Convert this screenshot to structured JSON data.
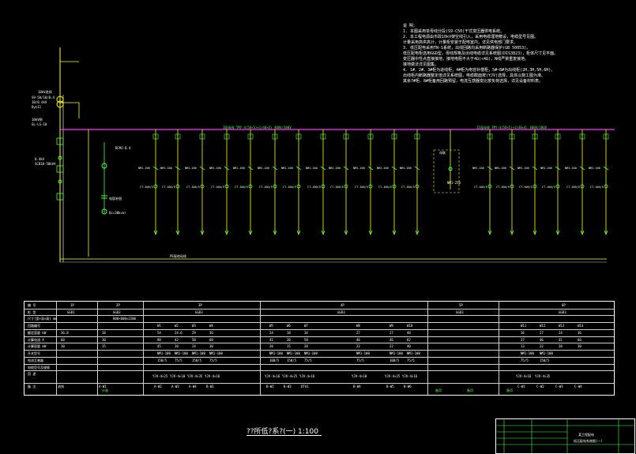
{
  "notes": {
    "heading": "说 明：",
    "lines": [
      "1. 本图采用单母线分段(S9-C50)干式变压器供电系统。",
      "2. 本工程电源由市政10kV架空线引入，采用电缆埋地敷设，电缆型号见图。",
      "   计量采用高供高计，计量柜安装于配电室内，详见供电部门要求。",
      "3. 低压配电采用TN-S系统，出线回路均采用断路器保护(GB 50053)。",
      "   低压配电柜选用GGD型，母线规格及出线电缆详见系统图(DIS3823)，柜体尺寸见平面。",
      "   变压器中性点直接接地，接地电阻不大于4Ω(<4Ω)，N线严禁重复接地。",
      "   接地做法详见图集。",
      "4. 1#、2#、3#柜为进线柜，4#柜为电容补偿柜，5#~8#为出线柜(2H,3H,5H,6H)。",
      "   出线柜内断路器整定值详见系统图，电缆截面按(YJV)选择，具体以施工图为准。",
      "   其余7#柜、8#柜备用回路预留，电流互感器变比按负荷选择，详见设备材料表。"
    ]
  },
  "diagram": {
    "left_labels": [
      "10kV进线",
      "S9-50/10/0.4",
      "10/0.4kV",
      "Dyn11",
      "10kV侧",
      "GL-LS-10",
      "0.4kV",
      "SCB10-50kVA"
    ],
    "bus1_label": "I段母线 TMY-4(50×5)+1(40×4) 400V/380V",
    "bus2_label": "II段母线 TMY-4(50×5)+1(40×4) 400V/380V",
    "ground_bus_label": "PE接地母线",
    "capacitor_labels": [
      "BCMJ-0.4",
      "电容补偿",
      "Qc=30kvar"
    ],
    "feeder_badge": "1",
    "breaker_label": "NM1-100",
    "ct_label": "CT-100/5",
    "tie_label": "母联",
    "tie_switch": "NM1-250"
  },
  "table": {
    "row_labels": [
      "编 号",
      "柜 型",
      "尺寸(宽×深×高) mm",
      "回路编号",
      "额定容量 kW",
      "计算电流 A",
      "计算容量 kW",
      "开关型号",
      "电流互感器",
      "电缆型号及规格",
      "用 途",
      "备 注"
    ],
    "col_headers": [
      "1P",
      "2P",
      "3P",
      "4P",
      "5P",
      "6P"
    ],
    "cabinet_types": [
      "GGD1",
      "GGD2",
      "GGD3",
      "GGD3",
      "GGD3",
      "GGD3"
    ],
    "circuit_ids": [
      "W1",
      "W2",
      "W3",
      "W4",
      "W5",
      "W6",
      "W7",
      "W8",
      "W9",
      "W10",
      "W11",
      "W12",
      "W13",
      "W14"
    ],
    "capacity": [
      "36.8",
      "18",
      "54",
      "24.6",
      "29",
      "36",
      "24",
      "18",
      "34",
      "27",
      "27",
      "48",
      "16",
      "27",
      "24",
      "36"
    ],
    "current": [
      "60",
      "30",
      "90",
      "42",
      "50",
      "60",
      "41",
      "30",
      "58",
      "46",
      "46",
      "82",
      "27",
      "46",
      "41",
      "60"
    ],
    "demand": [
      "30",
      "15",
      "45",
      "20",
      "24",
      "30",
      "20",
      "15",
      "28",
      "22",
      "22",
      "40",
      "13",
      "22",
      "20",
      "30"
    ],
    "switch_model": [
      "NM1-100",
      "NM1-100",
      "NM1-100",
      "NM1-100",
      "NM1-100",
      "NM1-100",
      "NM1-100",
      "NM1-100",
      "NM1-100",
      "NM1-100",
      "NM1-100",
      "NM1-100"
    ],
    "ct": [
      "150/5",
      "75/5",
      "150/5",
      "75/5",
      "100/5",
      "150/5",
      "75/5",
      "75/5",
      "100/5",
      "75/5",
      "75/5",
      "150/5"
    ],
    "cable": [
      "YJV-4×25",
      "YJV-4×10",
      "YJV-4×35",
      "YJV-4×16",
      "YJV-4×16",
      "YJV-4×25",
      "YJV-4×16",
      "YJV-4×10",
      "YJV-4×25",
      "YJV-4×16",
      "YJV-4×16",
      "YJV-4×35"
    ],
    "usage": [
      "进线",
      "A-W1",
      "A-W2",
      "A-W3",
      "A-W4",
      "B-W1",
      "B-W2",
      "B-W3",
      "DTA1",
      "B-W4",
      "B-W5",
      "B-W6",
      "C-W1",
      "C-W2",
      "C-W3",
      "C-W4"
    ],
    "note_cells": [
      "计量",
      "备用",
      "备用",
      "备用"
    ],
    "size_text": "800×600×2200"
  },
  "drawing_title": "??所低?系?(一) 1:100",
  "title_block": {
    "project": "某工程配电",
    "drawing_name": "低压配电系统图(一)"
  }
}
